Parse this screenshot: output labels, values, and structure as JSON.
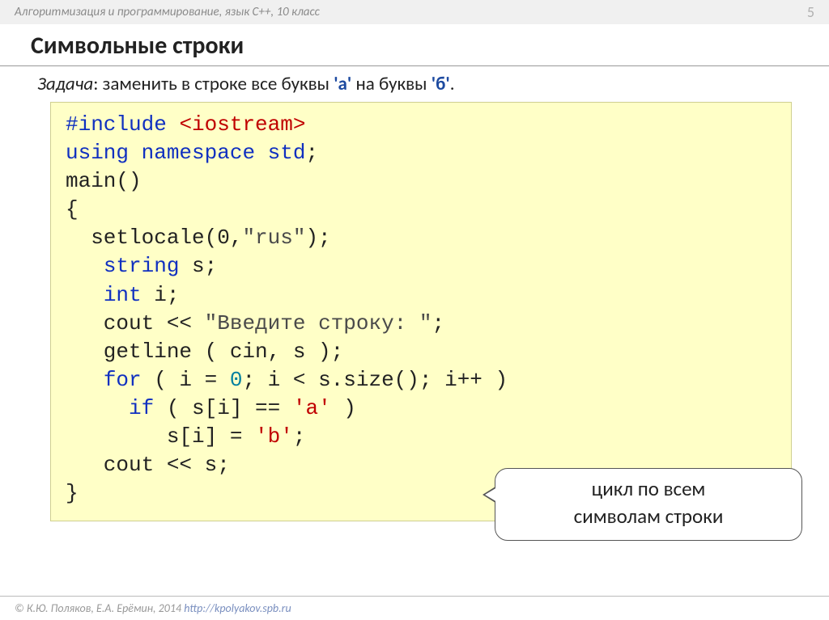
{
  "header": {
    "course": "Алгоритмизация и программирование, язык C++, 10 класс",
    "page_number": "5"
  },
  "title": "Символьные строки",
  "problem": {
    "label": "Задача",
    "text": ": заменить в строке все буквы ",
    "a_char": "'а'",
    "middle": " на буквы ",
    "b_char": "'б'",
    "end": "."
  },
  "code": {
    "l1_include": "#include ",
    "l1_header": "<iostream>",
    "l2_using": "using ",
    "l2_namespace": "namespace ",
    "l2_std": "std",
    "l2_semi": ";",
    "l3": "main()",
    "l4": "{",
    "l5_pre": "  setlocale(0,",
    "l5_str": "\"rus\"",
    "l5_post": ");",
    "l6_pre": "   ",
    "l6_kw": "string",
    "l6_post": " s;",
    "l7_pre": "   ",
    "l7_kw": "int",
    "l7_post": " i;",
    "l8_pre": "   cout << ",
    "l8_str": "\"Введите строку: \"",
    "l8_post": ";",
    "l9": "   getline ( cin, s );",
    "l10_pre": "   ",
    "l10_for": "for",
    "l10_mid1": " ( i = ",
    "l10_zero": "0",
    "l10_mid2": "; i < s.size(); i++ )",
    "l11_pre": "     ",
    "l11_if": "if",
    "l11_mid1": " ( s[i] == ",
    "l11_chr": "'a'",
    "l11_mid2": " )",
    "l12_pre": "        s[i] = ",
    "l12_chr": "'b'",
    "l12_post": ";",
    "l13": "   cout << s;",
    "l14": "}"
  },
  "callout": {
    "line1": "цикл по всем",
    "line2": "символам строки"
  },
  "footer": {
    "copyright": "© К.Ю. Поляков, Е.А. Ерёмин, 2014   ",
    "url": "http://kpolyakov.spb.ru"
  }
}
